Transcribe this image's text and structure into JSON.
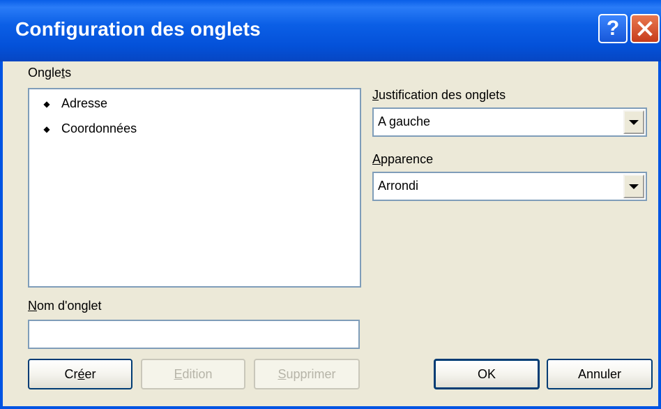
{
  "window": {
    "title": "Configuration des onglets",
    "help_glyph": "?",
    "close_glyph": "✕"
  },
  "tabs_list": {
    "label_prefix": "Ongle",
    "label_mnemonic": "t",
    "label_suffix": "s",
    "items": [
      {
        "icon": "diamond-bullet",
        "label": "Adresse"
      },
      {
        "icon": "diamond-bullet",
        "label": "Coordonnées"
      }
    ]
  },
  "tab_name": {
    "label_mnemonic": "N",
    "label_suffix": "om d'onglet",
    "value": ""
  },
  "buttons": {
    "create_prefix": "Cr",
    "create_mnemonic": "é",
    "create_suffix": "er",
    "edit_mnemonic": "E",
    "edit_suffix": "dition",
    "delete_mnemonic": "S",
    "delete_suffix": "upprimer",
    "ok": "OK",
    "cancel": "Annuler"
  },
  "justification": {
    "label_mnemonic": "J",
    "label_suffix": "ustification des onglets",
    "selected": "A gauche"
  },
  "appearance": {
    "label_mnemonic": "A",
    "label_suffix": "pparence",
    "selected": "Arrondi"
  },
  "colors": {
    "titlebar": "#0054e3",
    "dialog_background": "#ece9d8",
    "field_border": "#7f9db9",
    "disabled_text": "#b6b4a8"
  }
}
